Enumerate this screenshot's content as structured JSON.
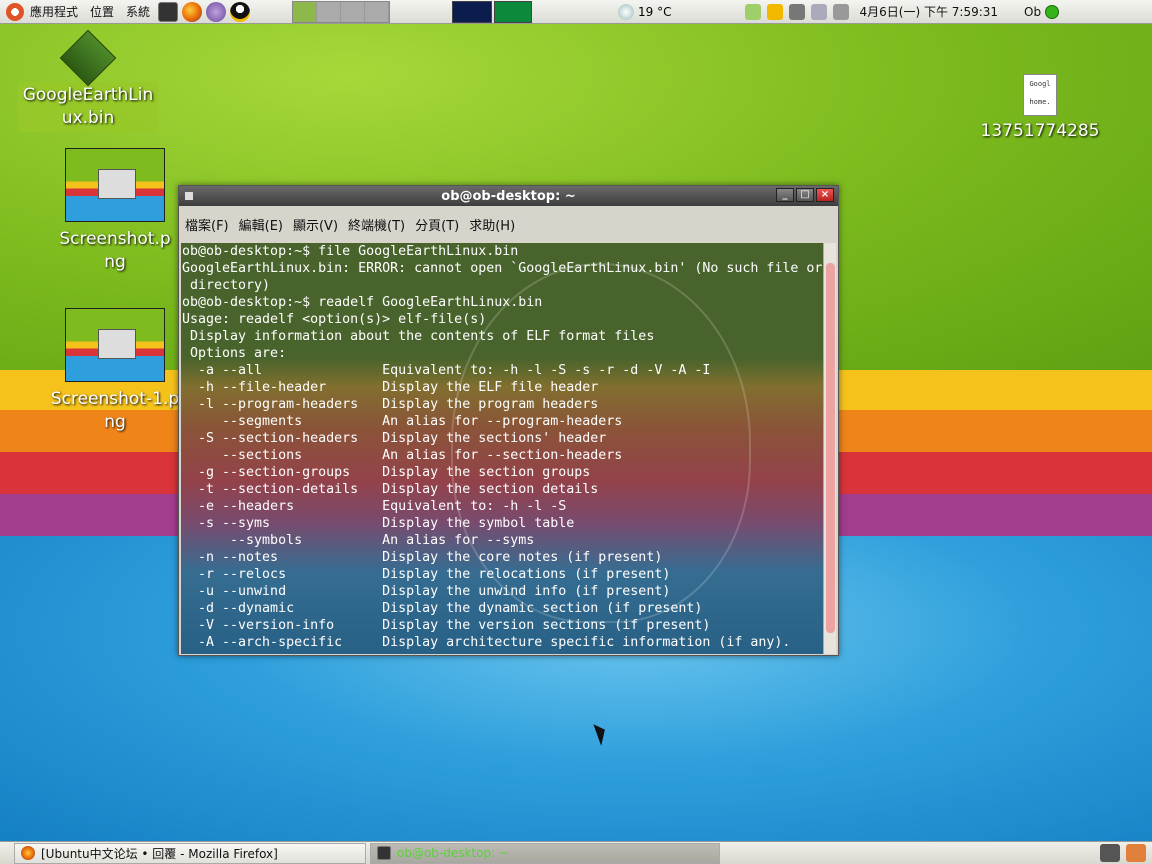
{
  "top_panel": {
    "menus": [
      "應用程式",
      "位置",
      "系統"
    ],
    "launchers": [
      "terminal-icon",
      "firefox-icon",
      "pidgin-icon",
      "qq-icon"
    ],
    "weather": "19 °C",
    "clock": "4月6日(一) 下午  7:59:31",
    "user": "Ob"
  },
  "desktop": {
    "icons": [
      {
        "label": "GoogleEarthLinux.bin"
      },
      {
        "label": "Screenshot.png"
      },
      {
        "label": "Screenshot-1.png"
      },
      {
        "label": "13751774285",
        "doc_text": "Googl home."
      }
    ]
  },
  "terminal": {
    "title": "ob@ob-desktop: ~",
    "menu": [
      "檔案(F)",
      "編輯(E)",
      "顯示(V)",
      "終端機(T)",
      "分頁(T)",
      "求助(H)"
    ],
    "lines": [
      "ob@ob-desktop:~$ file GoogleEarthLinux.bin",
      "GoogleEarthLinux.bin: ERROR: cannot open `GoogleEarthLinux.bin' (No such file or",
      " directory)",
      "ob@ob-desktop:~$ readelf GoogleEarthLinux.bin",
      "Usage: readelf <option(s)> elf-file(s)",
      " Display information about the contents of ELF format files",
      " Options are:",
      "  -a --all               Equivalent to: -h -l -S -s -r -d -V -A -I",
      "  -h --file-header       Display the ELF file header",
      "  -l --program-headers   Display the program headers",
      "     --segments          An alias for --program-headers",
      "  -S --section-headers   Display the sections' header",
      "     --sections          An alias for --section-headers",
      "  -g --section-groups    Display the section groups",
      "  -t --section-details   Display the section details",
      "  -e --headers           Equivalent to: -h -l -S",
      "  -s --syms              Display the symbol table",
      "      --symbols          An alias for --syms",
      "  -n --notes             Display the core notes (if present)",
      "  -r --relocs            Display the relocations (if present)",
      "  -u --unwind            Display the unwind info (if present)",
      "  -d --dynamic           Display the dynamic section (if present)",
      "  -V --version-info      Display the version sections (if present)",
      "  -A --arch-specific     Display architecture specific information (if any)."
    ]
  },
  "taskbar": {
    "tasks": [
      "[Ubuntu中文论坛 • 回覆 - Mozilla Firefox]",
      "ob@ob-desktop: ~"
    ]
  }
}
